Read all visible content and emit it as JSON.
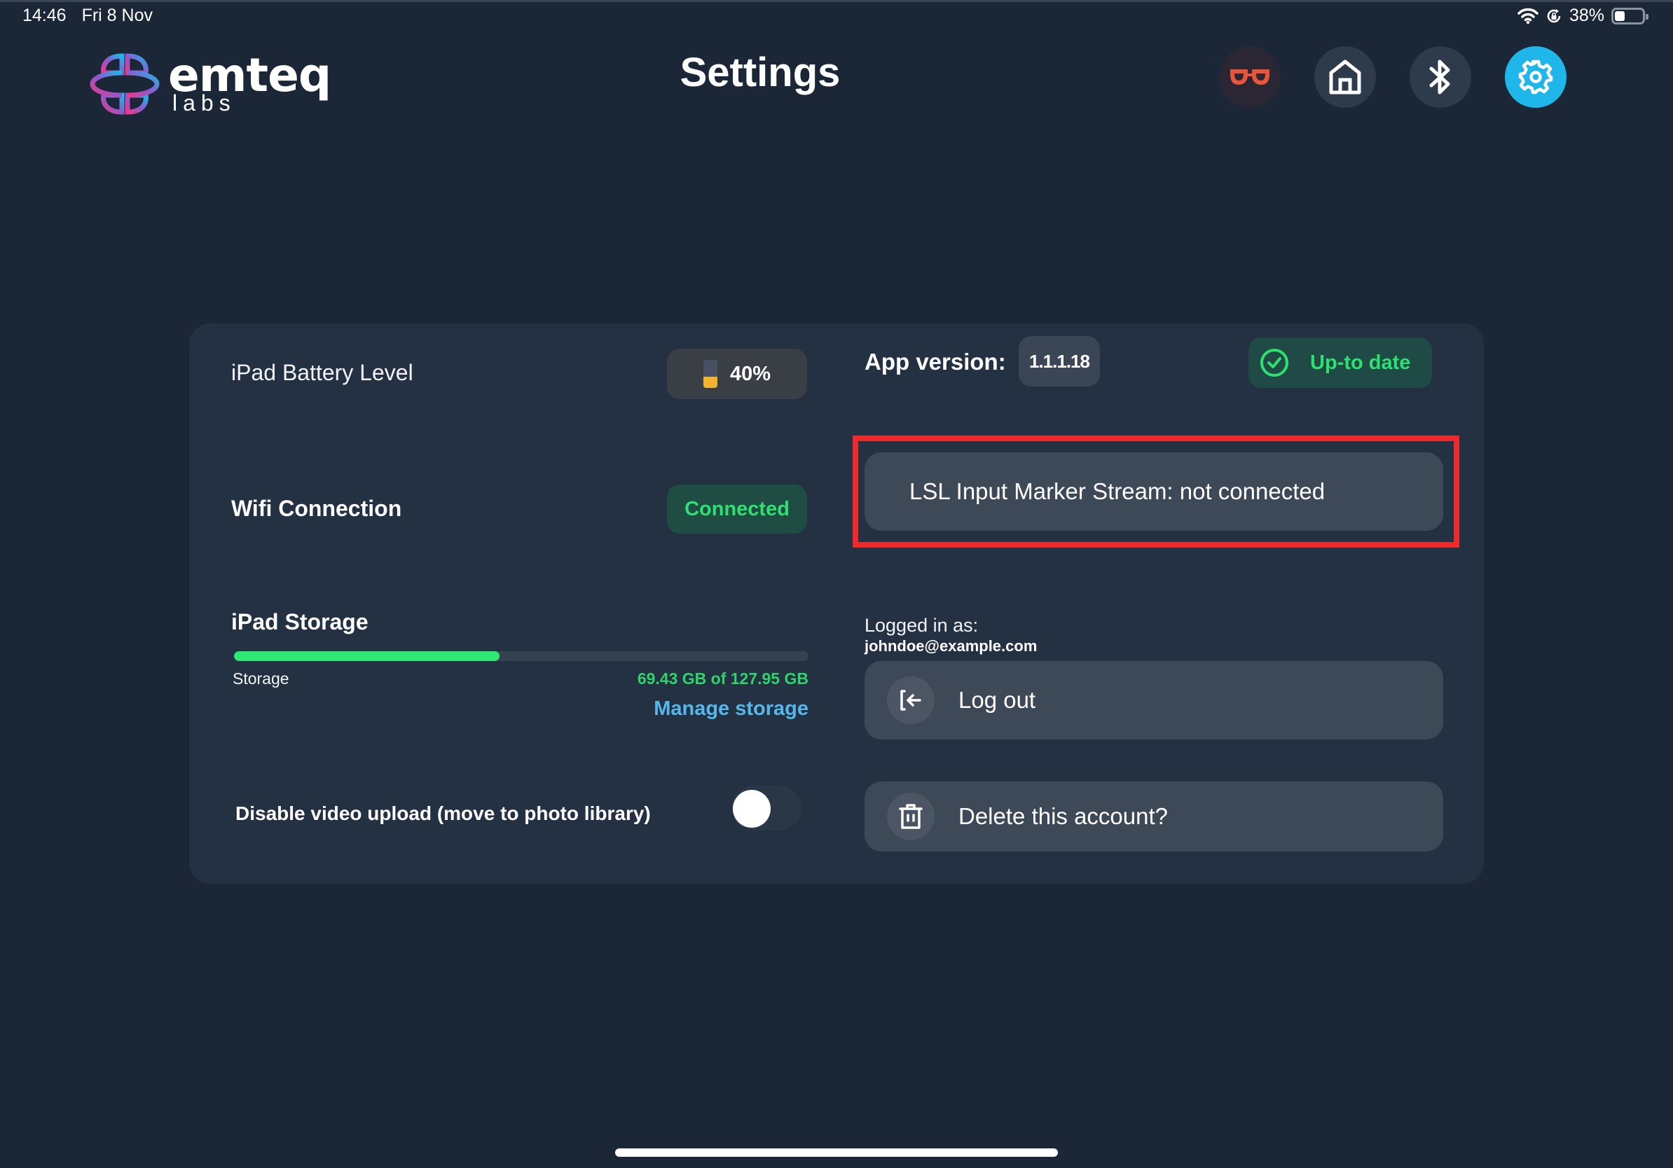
{
  "status_bar": {
    "time": "14:46",
    "date": "Fri 8 Nov",
    "battery_percent_label": "38%",
    "battery_level": 0.38,
    "icons": [
      "wifi-icon",
      "rotation-lock-icon",
      "battery-icon"
    ]
  },
  "brand": {
    "name": "emteq",
    "sub": "labs"
  },
  "header": {
    "title": "Settings",
    "nav": [
      {
        "name": "glasses",
        "icon": "glasses-icon",
        "color": "#e8553a"
      },
      {
        "name": "home",
        "icon": "home-icon"
      },
      {
        "name": "bluetooth",
        "icon": "bluetooth-icon"
      },
      {
        "name": "settings",
        "icon": "gear-icon",
        "active": true,
        "color": "#1fb6ea"
      }
    ]
  },
  "settings": {
    "battery": {
      "label": "iPad Battery Level",
      "value": "40%",
      "level": 0.4,
      "color": "#f0b432"
    },
    "wifi": {
      "label": "Wifi Connection",
      "status": "Connected",
      "status_color": "#2ee06f"
    },
    "storage": {
      "title": "iPad Storage",
      "sub_label": "Storage",
      "used_gb": 69.43,
      "total_gb": 127.95,
      "value_text": "69.43 GB of 127.95 GB",
      "fraction_used": 0.4627,
      "manage_link": "Manage storage"
    },
    "video_upload": {
      "label": "Disable video upload (move to photo library)",
      "enabled": false
    },
    "app": {
      "version_label": "App version:",
      "version": "1.1.1.18",
      "update_status": "Up-to date"
    },
    "lsl": {
      "text": "LSL Input Marker Stream: not connected",
      "highlight_color": "#ee2a2d"
    },
    "account": {
      "logged_in_label": "Logged in as:",
      "email": "johndoe@example.com",
      "logout_label": "Log out",
      "delete_label": "Delete this account?"
    }
  }
}
